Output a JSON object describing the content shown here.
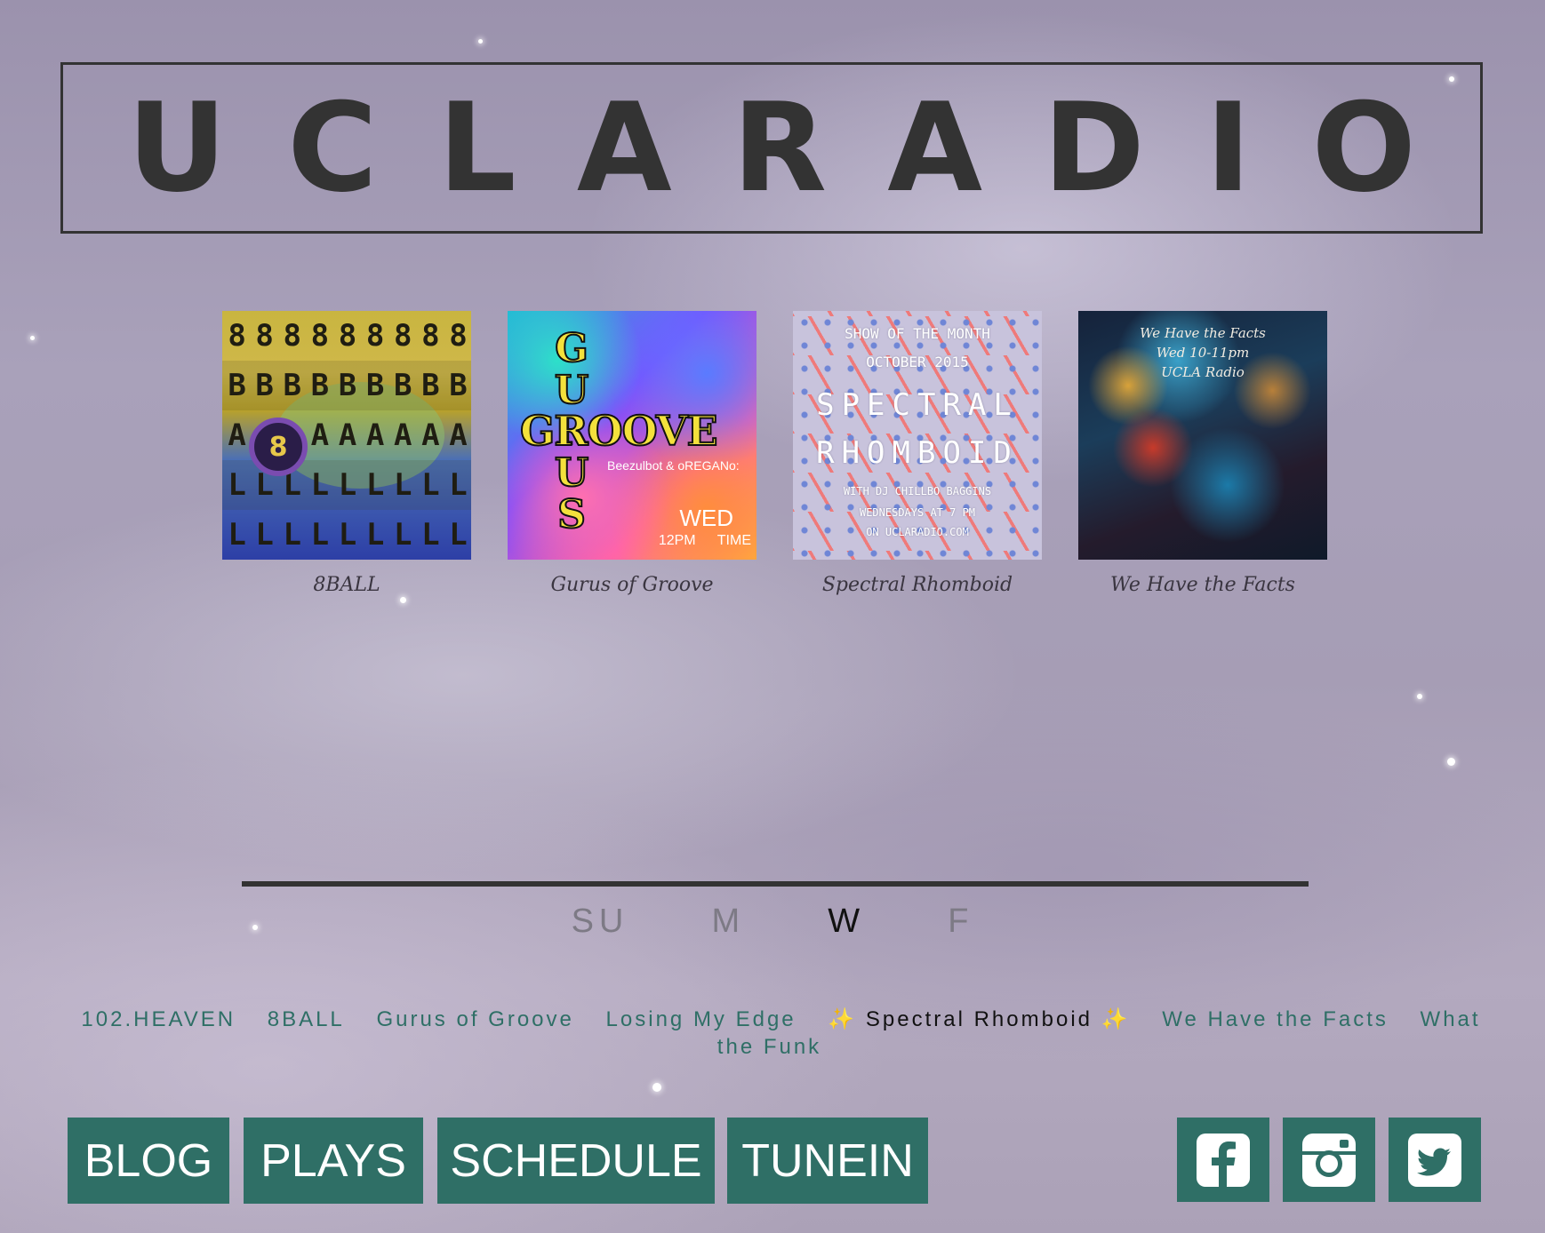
{
  "header": {
    "logo_letters": [
      "U",
      "C",
      "L",
      "A",
      "R",
      "A",
      "D",
      "I",
      "O"
    ]
  },
  "featured": [
    {
      "title": "8BALL",
      "art_text": [
        "8",
        "B",
        "A",
        "L",
        "L"
      ]
    },
    {
      "title": "Gurus of Groove",
      "art_letters": [
        "G",
        "U",
        "R",
        "U",
        "S"
      ],
      "art_word": "GROOVE",
      "art_hosts": "Beezulbot & oREGANo:",
      "art_day": "WED",
      "art_time": "12PM TIME"
    },
    {
      "title": "Spectral Rhomboid",
      "art_lines": [
        "SHOW OF THE MONTH",
        "OCTOBER 2015",
        "SPECTRAL",
        "RHOMBOID",
        "WITH DJ CHILLBO BAGGINS",
        "WEDNESDAYS AT 7 PM",
        "ON UCLARADIO.COM"
      ]
    },
    {
      "title": "We Have the Facts",
      "art_lines": [
        "We Have the Facts",
        "Wed 10-11pm",
        "UCLA Radio"
      ]
    }
  ],
  "days": [
    {
      "label": "SU",
      "active": false
    },
    {
      "label": "M",
      "active": false
    },
    {
      "label": "W",
      "active": true
    },
    {
      "label": "F",
      "active": false
    }
  ],
  "shows": [
    {
      "label": "102.HEAVEN",
      "current": false
    },
    {
      "label": "8BALL",
      "current": false
    },
    {
      "label": "Gurus of Groove",
      "current": false
    },
    {
      "label": "Losing My Edge",
      "current": false
    },
    {
      "label": "Spectral Rhomboid",
      "current": true,
      "decoration": "✨"
    },
    {
      "label": "We Have the Facts",
      "current": false
    },
    {
      "label": "What the Funk",
      "current": false
    }
  ],
  "nav": {
    "blog": "BLOG",
    "plays": "PLAYS",
    "schedule": "SCHEDULE",
    "tunein": "TUNEIN"
  },
  "social": [
    "facebook-icon",
    "instagram-icon",
    "twitter-icon"
  ],
  "colors": {
    "accent": "#2f6f66",
    "text_dark": "#333333",
    "inactive_day": "#7d7a85"
  }
}
